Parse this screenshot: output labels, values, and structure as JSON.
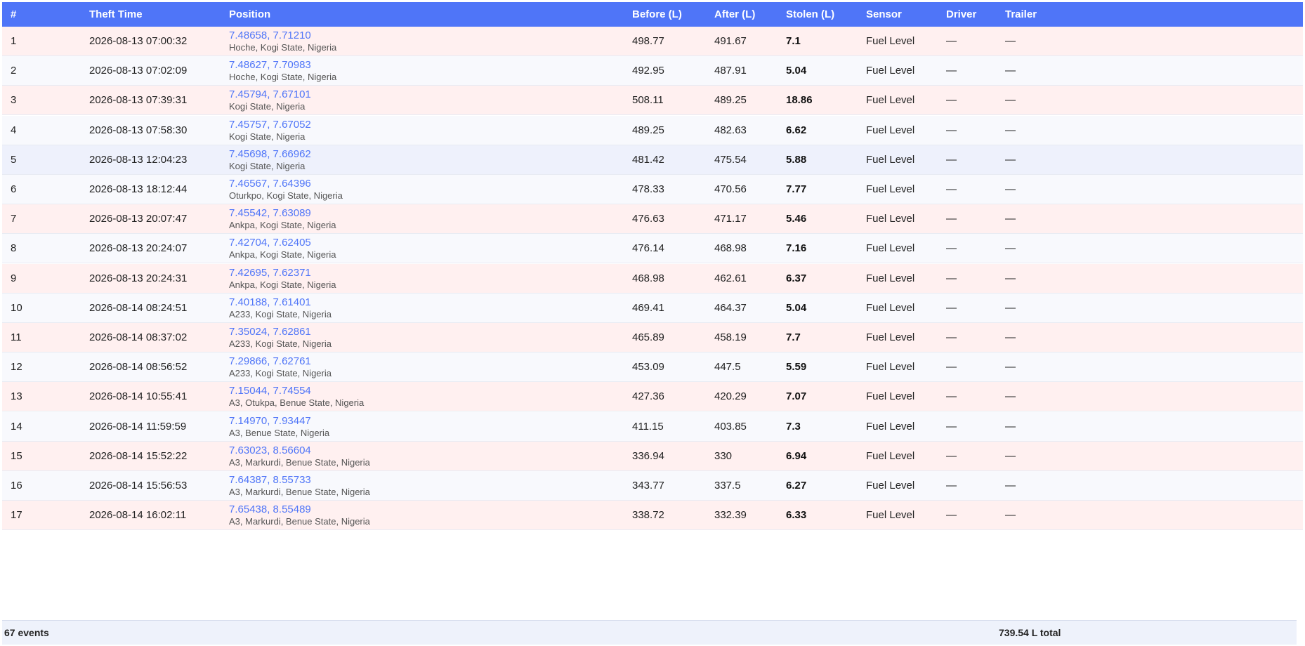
{
  "table": {
    "headers": {
      "index": "#",
      "theft_time": "Theft Time",
      "position": "Position",
      "before": "Before (L)",
      "after": "After (L)",
      "stolen": "Stolen (L)",
      "sensor": "Sensor",
      "driver": "Driver",
      "trailer": "Trailer"
    },
    "rows": [
      {
        "index": "1",
        "time": "2026-08-13 07:00:32",
        "coords": "7.48658, 7.71210",
        "address": "Hoche, Kogi State, Nigeria",
        "before": "498.77",
        "after": "491.67",
        "stolen": "7.1",
        "sensor": "Fuel Level",
        "driver": "—",
        "trailer": "—"
      },
      {
        "index": "2",
        "time": "2026-08-13 07:02:09",
        "coords": "7.48627, 7.70983",
        "address": "Hoche, Kogi State, Nigeria",
        "before": "492.95",
        "after": "487.91",
        "stolen": "5.04",
        "sensor": "Fuel Level",
        "driver": "—",
        "trailer": "—"
      },
      {
        "index": "3",
        "time": "2026-08-13 07:39:31",
        "coords": "7.45794, 7.67101",
        "address": "Kogi State, Nigeria",
        "before": "508.11",
        "after": "489.25",
        "stolen": "18.86",
        "sensor": "Fuel Level",
        "driver": "—",
        "trailer": "—"
      },
      {
        "index": "4",
        "time": "2026-08-13 07:58:30",
        "coords": "7.45757, 7.67052",
        "address": "Kogi State, Nigeria",
        "before": "489.25",
        "after": "482.63",
        "stolen": "6.62",
        "sensor": "Fuel Level",
        "driver": "—",
        "trailer": "—"
      },
      {
        "index": "5",
        "time": "2026-08-13 12:04:23",
        "coords": "7.45698, 7.66962",
        "address": "Kogi State, Nigeria",
        "before": "481.42",
        "after": "475.54",
        "stolen": "5.88",
        "sensor": "Fuel Level",
        "driver": "—",
        "trailer": "—"
      },
      {
        "index": "6",
        "time": "2026-08-13 18:12:44",
        "coords": "7.46567, 7.64396",
        "address": "Oturkpo, Kogi State, Nigeria",
        "before": "478.33",
        "after": "470.56",
        "stolen": "7.77",
        "sensor": "Fuel Level",
        "driver": "—",
        "trailer": "—"
      },
      {
        "index": "7",
        "time": "2026-08-13 20:07:47",
        "coords": "7.45542, 7.63089",
        "address": "Ankpa, Kogi State, Nigeria",
        "before": "476.63",
        "after": "471.17",
        "stolen": "5.46",
        "sensor": "Fuel Level",
        "driver": "—",
        "trailer": "—"
      },
      {
        "index": "8",
        "time": "2026-08-13 20:24:07",
        "coords": "7.42704, 7.62405",
        "address": "Ankpa, Kogi State, Nigeria",
        "before": "476.14",
        "after": "468.98",
        "stolen": "7.16",
        "sensor": "Fuel Level",
        "driver": "—",
        "trailer": "—"
      },
      {
        "index": "9",
        "time": "2026-08-13 20:24:31",
        "coords": "7.42695, 7.62371",
        "address": "Ankpa, Kogi State, Nigeria",
        "before": "468.98",
        "after": "462.61",
        "stolen": "6.37",
        "sensor": "Fuel Level",
        "driver": "—",
        "trailer": "—"
      },
      {
        "index": "10",
        "time": "2026-08-14 08:24:51",
        "coords": "7.40188, 7.61401",
        "address": "A233, Kogi State, Nigeria",
        "before": "469.41",
        "after": "464.37",
        "stolen": "5.04",
        "sensor": "Fuel Level",
        "driver": "—",
        "trailer": "—"
      },
      {
        "index": "11",
        "time": "2026-08-14 08:37:02",
        "coords": "7.35024, 7.62861",
        "address": "A233, Kogi State, Nigeria",
        "before": "465.89",
        "after": "458.19",
        "stolen": "7.7",
        "sensor": "Fuel Level",
        "driver": "—",
        "trailer": "—"
      },
      {
        "index": "12",
        "time": "2026-08-14 08:56:52",
        "coords": "7.29866, 7.62761",
        "address": "A233, Kogi State, Nigeria",
        "before": "453.09",
        "after": "447.5",
        "stolen": "5.59",
        "sensor": "Fuel Level",
        "driver": "—",
        "trailer": "—"
      },
      {
        "index": "13",
        "time": "2026-08-14 10:55:41",
        "coords": "7.15044, 7.74554",
        "address": "A3, Otukpa, Benue State, Nigeria",
        "before": "427.36",
        "after": "420.29",
        "stolen": "7.07",
        "sensor": "Fuel Level",
        "driver": "—",
        "trailer": "—"
      },
      {
        "index": "14",
        "time": "2026-08-14 11:59:59",
        "coords": "7.14970, 7.93447",
        "address": "A3, Benue State, Nigeria",
        "before": "411.15",
        "after": "403.85",
        "stolen": "7.3",
        "sensor": "Fuel Level",
        "driver": "—",
        "trailer": "—"
      },
      {
        "index": "15",
        "time": "2026-08-14 15:52:22",
        "coords": "7.63023, 8.56604",
        "address": "A3, Markurdi, Benue State, Nigeria",
        "before": "336.94",
        "after": "330",
        "stolen": "6.94",
        "sensor": "Fuel Level",
        "driver": "—",
        "trailer": "—"
      },
      {
        "index": "16",
        "time": "2026-08-14 15:56:53",
        "coords": "7.64387, 8.55733",
        "address": "A3, Markurdi, Benue State, Nigeria",
        "before": "343.77",
        "after": "337.5",
        "stolen": "6.27",
        "sensor": "Fuel Level",
        "driver": "—",
        "trailer": "—"
      },
      {
        "index": "17",
        "time": "2026-08-14 16:02:11",
        "coords": "7.65438, 8.55489",
        "address": "A3, Markurdi, Benue State, Nigeria",
        "before": "338.72",
        "after": "332.39",
        "stolen": "6.33",
        "sensor": "Fuel Level",
        "driver": "—",
        "trailer": "—"
      }
    ],
    "footer": {
      "events": "67 events",
      "total": "739.54 L total"
    }
  },
  "colors": {
    "header_bg": "#4f75f8",
    "link": "#4f75f8",
    "row_odd": "#fff0f0",
    "row_even": "#f8f9fd",
    "row_highlight": "#eef1fc",
    "footer_bg": "#eef2fb"
  }
}
